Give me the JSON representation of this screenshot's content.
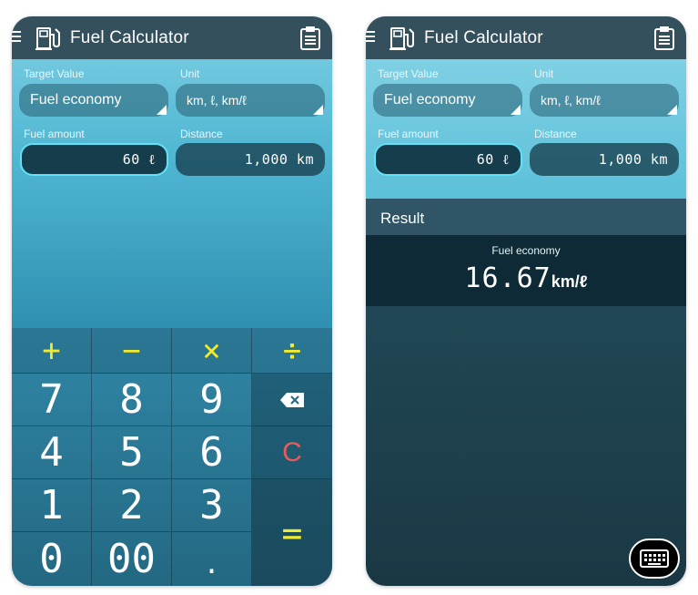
{
  "app": {
    "title": "Fuel Calculator",
    "icons": {
      "menu": "menu-icon",
      "pump": "fuel-pump-icon",
      "clipboard": "clipboard-icon"
    }
  },
  "form": {
    "target_label": "Target Value",
    "target_value": "Fuel economy",
    "unit_label": "Unit",
    "unit_value": "km, ℓ, km/ℓ",
    "fuel_label": "Fuel amount",
    "fuel_value": "60 ℓ",
    "distance_label": "Distance",
    "distance_value": "1,000 km"
  },
  "keypad": {
    "ops": [
      "+",
      "−",
      "×",
      "÷"
    ],
    "row1": [
      "7",
      "8",
      "9"
    ],
    "row2": [
      "4",
      "5",
      "6"
    ],
    "row3": [
      "1",
      "2",
      "3"
    ],
    "row4": [
      "0",
      "00",
      "."
    ],
    "clear": "C",
    "equals": "=",
    "backspace_icon": "backspace-icon"
  },
  "result": {
    "header": "Result",
    "label": "Fuel economy",
    "value": "16.67",
    "unit": "km/ℓ",
    "keyboard_icon": "keyboard-icon"
  },
  "colors": {
    "operator": "#f2ea2c",
    "clear": "#e85b5b",
    "active_border": "#5fe2f5",
    "appbar": "#35505d"
  }
}
